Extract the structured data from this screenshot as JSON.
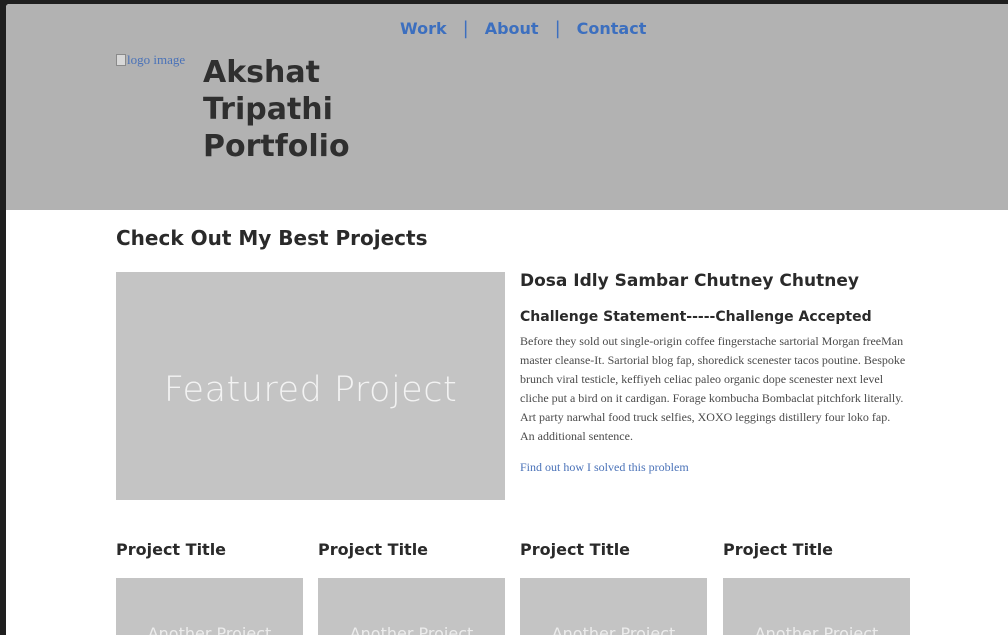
{
  "nav": {
    "items": [
      {
        "label": "Work"
      },
      {
        "label": "About"
      },
      {
        "label": "Contact"
      }
    ],
    "separator": "|"
  },
  "header": {
    "logo_alt": "logo image",
    "title_line1": "Akshat",
    "title_line2": "Tripathi",
    "title_line3": "Portfolio"
  },
  "main": {
    "section_title": "Check Out My Best Projects",
    "featured": {
      "image_label": "Featured Project",
      "title": "Dosa Idly Sambar Chutney Chutney",
      "challenge": "Challenge Statement-----Challenge Accepted",
      "description": "Before they sold out single-origin coffee fingerstache sartorial Morgan freeMan master cleanse-It. Sartorial blog fap, shoredick scenester tacos poutine. Bespoke brunch viral testicle, keffiyeh celiac paleo organic dope scenester next level cliche put a bird on it cardigan. Forage kombucha Bombaclat pitchfork literally. Art party narwhal food truck selfies, XOXO leggings distillery four loko fap. An additional sentence.",
      "link": "Find out how I solved this problem"
    },
    "projects": [
      {
        "title": "Project Title",
        "image_label": "Another Project"
      },
      {
        "title": "Project Title",
        "image_label": "Another Project"
      },
      {
        "title": "Project Title",
        "image_label": "Another Project"
      },
      {
        "title": "Project Title",
        "image_label": "Another Project"
      }
    ]
  },
  "colors": {
    "header_bg": "#b2b2b2",
    "link": "#3c6fbf",
    "placeholder": "#c4c4c4"
  }
}
